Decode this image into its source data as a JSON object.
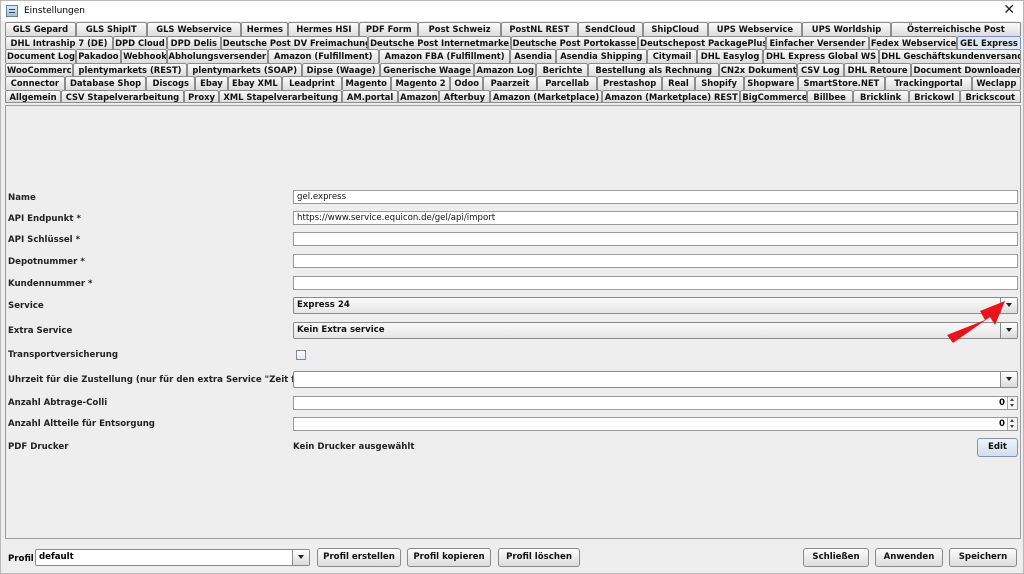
{
  "window": {
    "title": "Einstellungen",
    "close_glyph": "✕"
  },
  "tabs": {
    "rows": [
      [
        "GLS Gepard",
        "GLS ShipIT",
        "GLS Webservice",
        "Hermes",
        "Hermes HSI",
        "PDF Form",
        "Post Schweiz",
        "PostNL REST",
        "SendCloud",
        "ShipCloud",
        "UPS Webservice",
        "UPS Worldship",
        "Österreichische Post"
      ],
      [
        "DHL Intraship 7 (DE)",
        "DPD Cloud",
        "DPD Delis",
        "Deutsche Post DV Freimachung",
        "Deutsche Post Internetmarke",
        "Deutsche Post Portokasse",
        "Deutschepost PackagePlus",
        "Einfacher Versender",
        "Fedex Webservice",
        "GEL Express"
      ],
      [
        "Document Log",
        "Pakadoo",
        "Webhook",
        "Abholungsversender",
        "Amazon (Fulfillment)",
        "Amazon FBA (Fulfillment)",
        "Asendia",
        "Asendia Shipping",
        "Citymail",
        "DHL Easylog",
        "DHL Express Global WS",
        "DHL Geschäftskundenversand"
      ],
      [
        "WooCommerce",
        "plentymarkets (REST)",
        "plentymarkets (SOAP)",
        "Dipse (Waage)",
        "Generische Waage",
        "Amazon Log",
        "Berichte",
        "Bestellung als Rechnung",
        "CN2x Dokument",
        "CSV Log",
        "DHL Retoure",
        "Document Downloader"
      ],
      [
        "Connector",
        "Database Shop",
        "Discogs",
        "Ebay",
        "Ebay XML",
        "Leadprint",
        "Magento",
        "Magento 2",
        "Odoo",
        "Paarzeit",
        "Parcellab",
        "Prestashop",
        "Real",
        "Shopify",
        "Shopware",
        "SmartStore.NET",
        "Trackingportal",
        "Weclapp"
      ],
      [
        "Allgemein",
        "CSV Stapelverarbeitung",
        "Proxy",
        "XML Stapelverarbeitung",
        "AM.portal",
        "Amazon",
        "Afterbuy",
        "Amazon (Marketplace)",
        "Amazon (Marketplace) REST",
        "BigCommerce",
        "Billbee",
        "Bricklink",
        "Brickowl",
        "Brickscout"
      ]
    ],
    "selected": "GEL Express"
  },
  "form": {
    "name": {
      "label": "Name",
      "value": "gel.express"
    },
    "api_endpoint": {
      "label": "API Endpunkt *",
      "value": "https://www.service.equicon.de/gel/api/import"
    },
    "api_key": {
      "label": "API Schlüssel *",
      "value": ""
    },
    "depot": {
      "label": "Depotnummer *",
      "value": ""
    },
    "customer": {
      "label": "Kundennummer *",
      "value": ""
    },
    "service": {
      "label": "Service",
      "value": "Express 24"
    },
    "extra_service": {
      "label": "Extra Service",
      "value": "Kein Extra service"
    },
    "insurance": {
      "label": "Transportversicherung",
      "checked": false
    },
    "delivery_time": {
      "label": "Uhrzeit für die Zustellung (nur für den extra Service \"Zeit festlegen\")",
      "value": ""
    },
    "pickup_colli": {
      "label": "Anzahl Abtrage-Colli",
      "value": "0"
    },
    "old_parts": {
      "label": "Anzahl Altteile für Entsorgung",
      "value": "0"
    },
    "pdf_printer": {
      "label": "PDF Drucker",
      "value": "Kein Drucker ausgewählt",
      "edit_label": "Edit"
    }
  },
  "annotation": {
    "color": "#e8141c"
  },
  "bottom": {
    "profile_label": "Profil",
    "profile_value": "default",
    "create_label": "Profil erstellen",
    "copy_label": "Profil kopieren",
    "delete_label": "Profil löschen",
    "close_label": "Schließen",
    "apply_label": "Anwenden",
    "save_label": "Speichern"
  }
}
